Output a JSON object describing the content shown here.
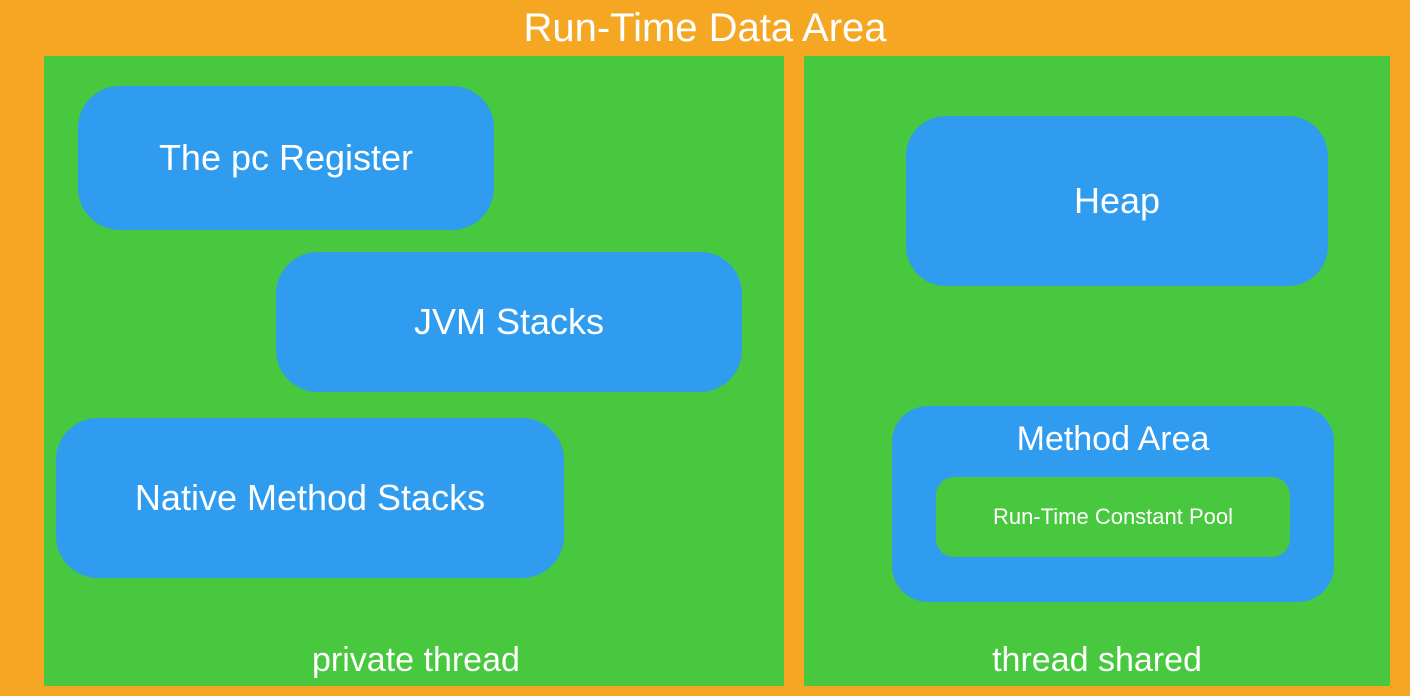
{
  "title": "Run-Time Data Area",
  "private_panel": {
    "caption": "private thread",
    "pc_register": "The pc Register",
    "jvm_stacks": "JVM Stacks",
    "native_stacks": "Native Method Stacks"
  },
  "shared_panel": {
    "caption": "thread shared",
    "heap": "Heap",
    "method_area": "Method Area",
    "constant_pool": "Run-Time Constant Pool"
  }
}
